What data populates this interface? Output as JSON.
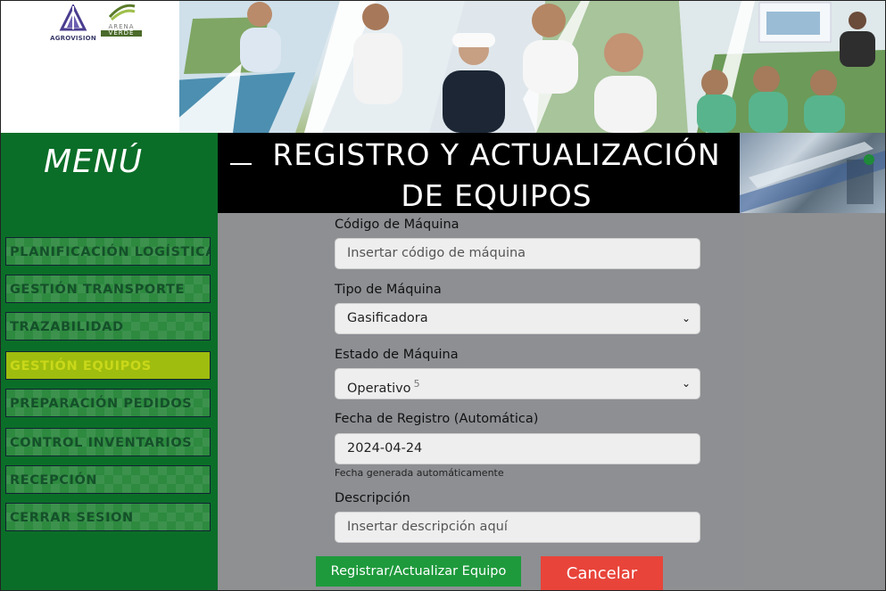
{
  "brand": {
    "logo1": "AGROVISION",
    "logo2_line1": "ARENA",
    "logo2_line2": "VERDE"
  },
  "sidebar": {
    "title": "MENÚ",
    "items": [
      {
        "label": "PLANIFICACIÓN LOGÍSTICA"
      },
      {
        "label": "GESTIÓN TRANSPORTE"
      },
      {
        "label": "TRAZABILIDAD"
      },
      {
        "label": "GESTIÓN EQUIPOS",
        "active": true
      },
      {
        "label": "PREPARACIÓN PEDIDOS"
      },
      {
        "label": "CONTROL INVENTARIOS"
      },
      {
        "label": "RECEPCIÓN"
      },
      {
        "label": "CERRAR SESION"
      }
    ]
  },
  "page": {
    "title_line1": "REGISTRO Y ACTUALIZACIÓN",
    "title_line2": "DE EQUIPOS"
  },
  "form": {
    "codigo": {
      "label": "Código de Máquina",
      "placeholder": "Insertar código de máquina"
    },
    "tipo": {
      "label": "Tipo de Máquina",
      "value": "Gasificadora"
    },
    "estado": {
      "label": "Estado de Máquina",
      "value": "Operativo",
      "superscript": "5"
    },
    "fecha": {
      "label": "Fecha de Registro (Automática)",
      "value": "2024-04-24",
      "help": "Fecha generada automáticamente"
    },
    "descripcion": {
      "label": "Descripción",
      "placeholder": "Insertar descripción aquí"
    }
  },
  "buttons": {
    "submit": "Registrar/Actualizar Equipo",
    "cancel": "Cancelar"
  },
  "icons": {
    "select_arrow": "chevron-down-icon"
  },
  "colors": {
    "sidebar_bg": "#0b6e28",
    "nav_active": "#9fbd0e",
    "submit_bg": "#1e9a3c",
    "cancel_bg": "#e8443a"
  }
}
